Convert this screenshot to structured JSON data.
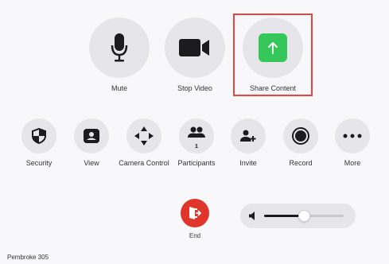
{
  "main_controls": {
    "mute": {
      "label": "Mute",
      "icon": "microphone-icon"
    },
    "stop_video": {
      "label": "Stop Video",
      "icon": "video-camera-icon"
    },
    "share_content": {
      "label": "Share Content",
      "icon": "share-arrow-icon",
      "color": "#35c759"
    }
  },
  "secondary_controls": {
    "security": {
      "label": "Security",
      "icon": "shield-icon"
    },
    "view": {
      "label": "View",
      "icon": "view-person-icon"
    },
    "camera_control": {
      "label": "Camera Control",
      "icon": "directional-arrows-icon"
    },
    "participants": {
      "label": "Participants",
      "count": "1",
      "icon": "participants-icon"
    },
    "invite": {
      "label": "Invite",
      "icon": "add-person-icon"
    },
    "record": {
      "label": "Record",
      "icon": "record-icon"
    },
    "more": {
      "label": "More",
      "icon": "ellipsis-icon"
    }
  },
  "end": {
    "label": "End",
    "icon": "exit-door-icon",
    "color": "#e0352b"
  },
  "volume": {
    "level": 0.5,
    "icon": "speaker-icon"
  },
  "room": {
    "name": "Pembroke 305"
  },
  "highlight_color": "#e8453c"
}
